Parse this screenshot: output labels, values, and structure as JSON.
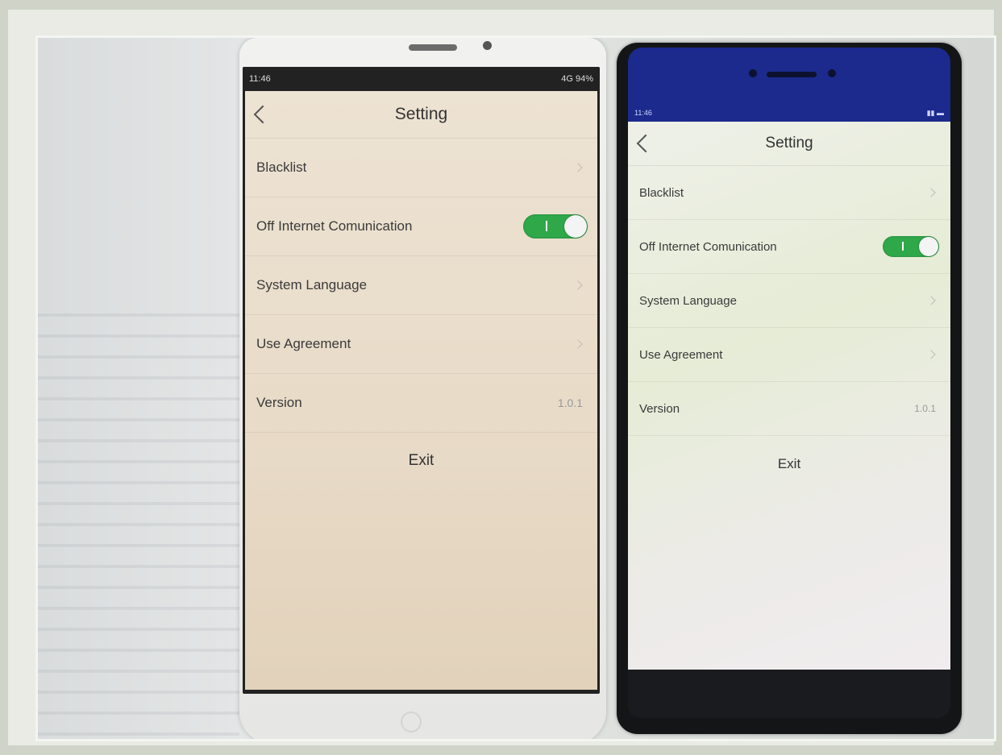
{
  "phone_left": {
    "status": {
      "time": "11:46",
      "right": "4G 94%"
    },
    "header": {
      "title": "Setting"
    },
    "rows": [
      {
        "label": "Blacklist"
      },
      {
        "label": "Off Internet Comunication",
        "toggle_on": true
      },
      {
        "label": "System Language"
      },
      {
        "label": "Use Agreement"
      },
      {
        "label": "Version",
        "value": "1.0.1"
      }
    ],
    "exit_label": "Exit"
  },
  "phone_right": {
    "status": {
      "time": "11:46"
    },
    "header": {
      "title": "Setting"
    },
    "rows": [
      {
        "label": "Blacklist"
      },
      {
        "label": "Off Internet Comunication",
        "toggle_on": true
      },
      {
        "label": "System Language"
      },
      {
        "label": "Use Agreement"
      },
      {
        "label": "Version",
        "value": "1.0.1"
      }
    ],
    "exit_label": "Exit"
  },
  "colors": {
    "toggle_on": "#2fa84a",
    "phone_right_bezel_top": "#1b2a8c"
  }
}
